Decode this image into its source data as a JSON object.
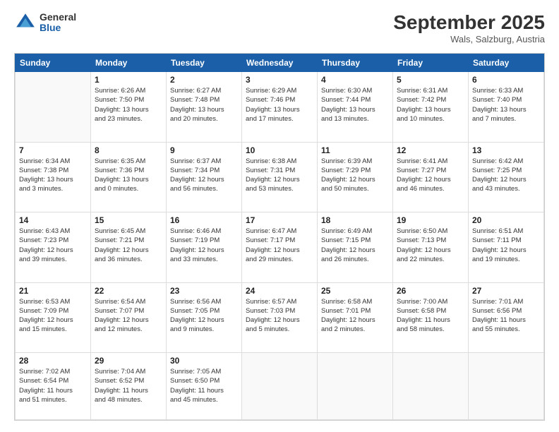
{
  "logo": {
    "general": "General",
    "blue": "Blue"
  },
  "title": "September 2025",
  "location": "Wals, Salzburg, Austria",
  "headers": [
    "Sunday",
    "Monday",
    "Tuesday",
    "Wednesday",
    "Thursday",
    "Friday",
    "Saturday"
  ],
  "weeks": [
    [
      {
        "day": "",
        "info": ""
      },
      {
        "day": "1",
        "info": "Sunrise: 6:26 AM\nSunset: 7:50 PM\nDaylight: 13 hours\nand 23 minutes."
      },
      {
        "day": "2",
        "info": "Sunrise: 6:27 AM\nSunset: 7:48 PM\nDaylight: 13 hours\nand 20 minutes."
      },
      {
        "day": "3",
        "info": "Sunrise: 6:29 AM\nSunset: 7:46 PM\nDaylight: 13 hours\nand 17 minutes."
      },
      {
        "day": "4",
        "info": "Sunrise: 6:30 AM\nSunset: 7:44 PM\nDaylight: 13 hours\nand 13 minutes."
      },
      {
        "day": "5",
        "info": "Sunrise: 6:31 AM\nSunset: 7:42 PM\nDaylight: 13 hours\nand 10 minutes."
      },
      {
        "day": "6",
        "info": "Sunrise: 6:33 AM\nSunset: 7:40 PM\nDaylight: 13 hours\nand 7 minutes."
      }
    ],
    [
      {
        "day": "7",
        "info": "Sunrise: 6:34 AM\nSunset: 7:38 PM\nDaylight: 13 hours\nand 3 minutes."
      },
      {
        "day": "8",
        "info": "Sunrise: 6:35 AM\nSunset: 7:36 PM\nDaylight: 13 hours\nand 0 minutes."
      },
      {
        "day": "9",
        "info": "Sunrise: 6:37 AM\nSunset: 7:34 PM\nDaylight: 12 hours\nand 56 minutes."
      },
      {
        "day": "10",
        "info": "Sunrise: 6:38 AM\nSunset: 7:31 PM\nDaylight: 12 hours\nand 53 minutes."
      },
      {
        "day": "11",
        "info": "Sunrise: 6:39 AM\nSunset: 7:29 PM\nDaylight: 12 hours\nand 50 minutes."
      },
      {
        "day": "12",
        "info": "Sunrise: 6:41 AM\nSunset: 7:27 PM\nDaylight: 12 hours\nand 46 minutes."
      },
      {
        "day": "13",
        "info": "Sunrise: 6:42 AM\nSunset: 7:25 PM\nDaylight: 12 hours\nand 43 minutes."
      }
    ],
    [
      {
        "day": "14",
        "info": "Sunrise: 6:43 AM\nSunset: 7:23 PM\nDaylight: 12 hours\nand 39 minutes."
      },
      {
        "day": "15",
        "info": "Sunrise: 6:45 AM\nSunset: 7:21 PM\nDaylight: 12 hours\nand 36 minutes."
      },
      {
        "day": "16",
        "info": "Sunrise: 6:46 AM\nSunset: 7:19 PM\nDaylight: 12 hours\nand 33 minutes."
      },
      {
        "day": "17",
        "info": "Sunrise: 6:47 AM\nSunset: 7:17 PM\nDaylight: 12 hours\nand 29 minutes."
      },
      {
        "day": "18",
        "info": "Sunrise: 6:49 AM\nSunset: 7:15 PM\nDaylight: 12 hours\nand 26 minutes."
      },
      {
        "day": "19",
        "info": "Sunrise: 6:50 AM\nSunset: 7:13 PM\nDaylight: 12 hours\nand 22 minutes."
      },
      {
        "day": "20",
        "info": "Sunrise: 6:51 AM\nSunset: 7:11 PM\nDaylight: 12 hours\nand 19 minutes."
      }
    ],
    [
      {
        "day": "21",
        "info": "Sunrise: 6:53 AM\nSunset: 7:09 PM\nDaylight: 12 hours\nand 15 minutes."
      },
      {
        "day": "22",
        "info": "Sunrise: 6:54 AM\nSunset: 7:07 PM\nDaylight: 12 hours\nand 12 minutes."
      },
      {
        "day": "23",
        "info": "Sunrise: 6:56 AM\nSunset: 7:05 PM\nDaylight: 12 hours\nand 9 minutes."
      },
      {
        "day": "24",
        "info": "Sunrise: 6:57 AM\nSunset: 7:03 PM\nDaylight: 12 hours\nand 5 minutes."
      },
      {
        "day": "25",
        "info": "Sunrise: 6:58 AM\nSunset: 7:01 PM\nDaylight: 12 hours\nand 2 minutes."
      },
      {
        "day": "26",
        "info": "Sunrise: 7:00 AM\nSunset: 6:58 PM\nDaylight: 11 hours\nand 58 minutes."
      },
      {
        "day": "27",
        "info": "Sunrise: 7:01 AM\nSunset: 6:56 PM\nDaylight: 11 hours\nand 55 minutes."
      }
    ],
    [
      {
        "day": "28",
        "info": "Sunrise: 7:02 AM\nSunset: 6:54 PM\nDaylight: 11 hours\nand 51 minutes."
      },
      {
        "day": "29",
        "info": "Sunrise: 7:04 AM\nSunset: 6:52 PM\nDaylight: 11 hours\nand 48 minutes."
      },
      {
        "day": "30",
        "info": "Sunrise: 7:05 AM\nSunset: 6:50 PM\nDaylight: 11 hours\nand 45 minutes."
      },
      {
        "day": "",
        "info": ""
      },
      {
        "day": "",
        "info": ""
      },
      {
        "day": "",
        "info": ""
      },
      {
        "day": "",
        "info": ""
      }
    ]
  ]
}
